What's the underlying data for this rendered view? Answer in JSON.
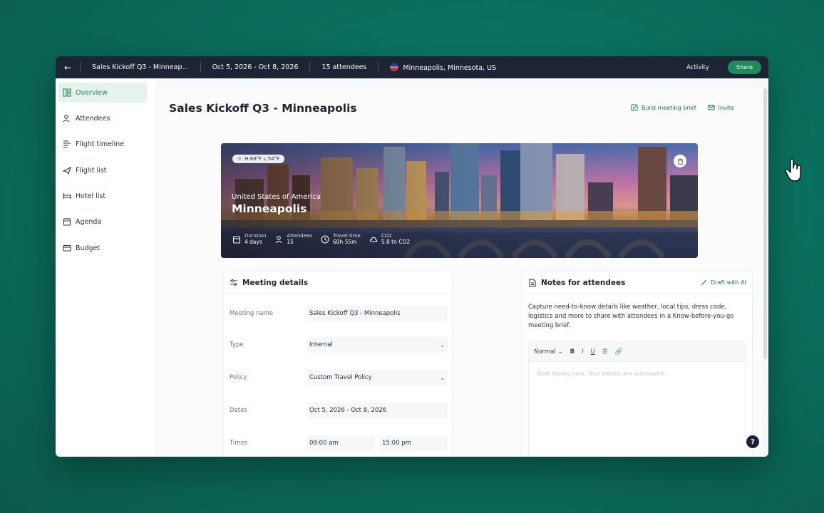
{
  "topbar": {
    "event_name": "Sales Kickoff Q3 - Minneap...",
    "dates": "Oct 5, 2026 - Oct 8, 2026",
    "attendees": "15 attendees",
    "location": "Minneapolis, Minnesota, US",
    "activity_label": "Activity",
    "share_label": "Share"
  },
  "sidebar": {
    "items": [
      {
        "label": "Overview",
        "icon": "overview-icon"
      },
      {
        "label": "Attendees",
        "icon": "attendees-icon"
      },
      {
        "label": "Flight timeline",
        "icon": "flight-timeline-icon"
      },
      {
        "label": "Flight list",
        "icon": "plane-icon"
      },
      {
        "label": "Hotel list",
        "icon": "bed-icon"
      },
      {
        "label": "Agenda",
        "icon": "calendar-icon"
      },
      {
        "label": "Budget",
        "icon": "wallet-icon"
      }
    ]
  },
  "main": {
    "title": "Sales Kickoff Q3 - Minneapolis",
    "build_brief_label": "Build meeting brief",
    "invite_label": "Invite"
  },
  "hero": {
    "weather": "H:68°F  L:54°F",
    "country": "United States of America",
    "city": "Minneapolis",
    "stats": [
      {
        "label": "Duration",
        "value": "4 days"
      },
      {
        "label": "Attendees",
        "value": "15"
      },
      {
        "label": "Travel time",
        "value": "60h 55m"
      },
      {
        "label": "CO2",
        "value": "5.8 tn CO2"
      }
    ]
  },
  "meeting_details": {
    "title": "Meeting details",
    "rows": {
      "name": {
        "label": "Meeting name",
        "value": "Sales Kickoff Q3 - Minneapolis"
      },
      "type": {
        "label": "Type",
        "value": "Internal"
      },
      "policy": {
        "label": "Policy",
        "value": "Custom Travel Policy"
      },
      "dates": {
        "label": "Dates",
        "value": "Oct 5, 2026 - Oct 8, 2026"
      },
      "times": {
        "label": "Times",
        "start": "09:00 am",
        "end": "15:00 pm"
      }
    }
  },
  "notes": {
    "title": "Notes for attendees",
    "draft_ai_label": "Draft with AI",
    "description": "Capture need-to-know details like weather, local tips, dress code, logistics and more to share with attendees in a Know-before-you-go meeting brief.",
    "format_label": "Normal",
    "bold": "B",
    "italic": "I",
    "underline": "U",
    "placeholder": "Start typing here. Your details are autosaved."
  },
  "help_label": "?",
  "colors": {
    "accent": "#1f8a5b",
    "topbar": "#1d2433",
    "background": "#0a6f5c"
  }
}
